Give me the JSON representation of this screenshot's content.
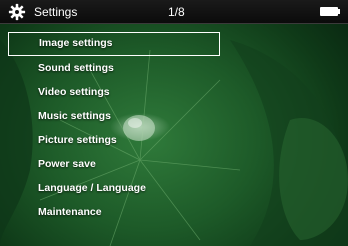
{
  "header": {
    "title": "Settings",
    "page_indicator": "1/8",
    "icon": "gear-icon",
    "battery_icon": "battery-icon"
  },
  "menu": {
    "selected_index": 0,
    "items": [
      {
        "label": "Image settings"
      },
      {
        "label": "Sound settings"
      },
      {
        "label": "Video settings"
      },
      {
        "label": "Music settings"
      },
      {
        "label": "Picture settings"
      },
      {
        "label": "Power save"
      },
      {
        "label": "Language / Language"
      },
      {
        "label": "Maintenance"
      }
    ]
  },
  "colors": {
    "text": "#ffffff",
    "header_bg": "#111111",
    "background": "#1d5a28"
  }
}
